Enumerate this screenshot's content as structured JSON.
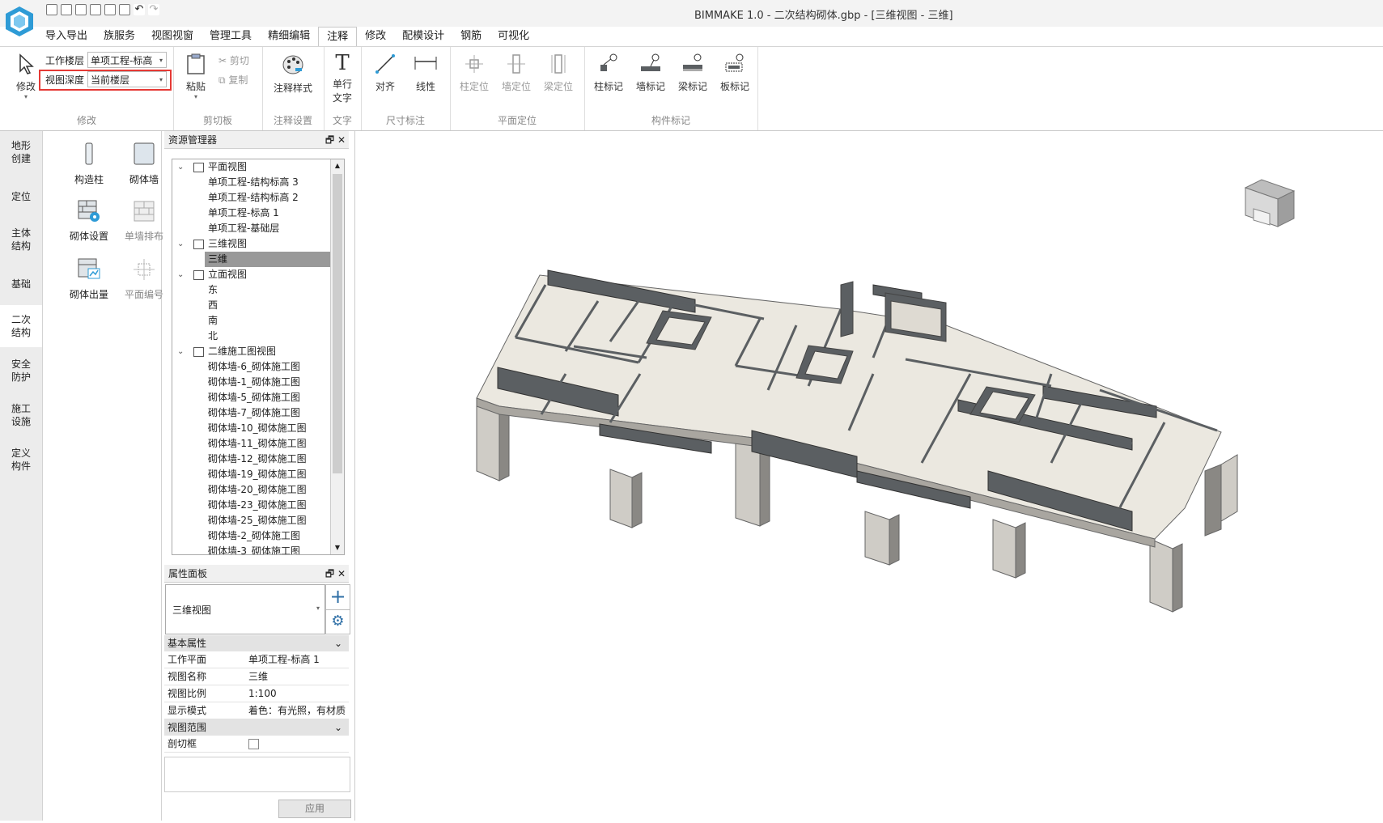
{
  "window": {
    "title": "BIMMAKE 1.0 - 二次结构砌体.gbp - [三维视图 - 三维]"
  },
  "menu_tabs": [
    "导入导出",
    "族服务",
    "视图视窗",
    "管理工具",
    "精细编辑",
    "注释",
    "修改",
    "配模设计",
    "钢筋",
    "可视化"
  ],
  "active_tab": "注释",
  "ribbon": {
    "modify": {
      "button": "修改",
      "work_floor_label": "工作楼层",
      "work_floor_value": "单项工程-标高",
      "view_depth_label": "视图深度",
      "view_depth_value": "当前楼层",
      "group": "修改"
    },
    "clipboard": {
      "paste": "粘贴",
      "cut": "剪切",
      "copy": "复制",
      "group": "剪切板"
    },
    "annotation_settings": {
      "style": "注释样式",
      "group": "注释设置"
    },
    "text": {
      "single_line": "单行\n文字",
      "single_line_a": "单行",
      "single_line_b": "文字",
      "group": "文字"
    },
    "dimension": {
      "align": "对齐",
      "linear": "线性",
      "group": "尺寸标注"
    },
    "plan_position": {
      "column": "柱定位",
      "wall": "墙定位",
      "beam": "梁定位",
      "group": "平面定位"
    },
    "component_mark": {
      "column": "柱标记",
      "wall": "墙标记",
      "beam": "梁标记",
      "slab": "板标记",
      "group": "构件标记"
    }
  },
  "left_nav": [
    {
      "a": "地形",
      "b": "创建"
    },
    {
      "a": "定位",
      "b": ""
    },
    {
      "a": "主体",
      "b": "结构"
    },
    {
      "a": "基础",
      "b": ""
    },
    {
      "a": "二次",
      "b": "结构"
    },
    {
      "a": "安全",
      "b": "防护"
    },
    {
      "a": "施工",
      "b": "设施"
    },
    {
      "a": "定义",
      "b": "构件"
    }
  ],
  "components": [
    {
      "label": "构造柱"
    },
    {
      "label": "砌体墙"
    },
    {
      "label": "砌体设置"
    },
    {
      "label": "单墙排布"
    },
    {
      "label": "砌体出量"
    },
    {
      "label": "平面编号"
    }
  ],
  "resource_manager": {
    "title": "资源管理器",
    "tree": [
      {
        "label": "平面视图",
        "level": 0
      },
      {
        "label": "单项工程-结构标高 3",
        "level": 1
      },
      {
        "label": "单项工程-结构标高 2",
        "level": 1
      },
      {
        "label": "单项工程-标高 1",
        "level": 1
      },
      {
        "label": "单项工程-基础层",
        "level": 1
      },
      {
        "label": "三维视图",
        "level": 0
      },
      {
        "label": "三维",
        "level": 1,
        "selected": true
      },
      {
        "label": "立面视图",
        "level": 0
      },
      {
        "label": "东",
        "level": 1
      },
      {
        "label": "西",
        "level": 1
      },
      {
        "label": "南",
        "level": 1
      },
      {
        "label": "北",
        "level": 1
      },
      {
        "label": "二维施工图视图",
        "level": 0
      },
      {
        "label": "砌体墙-6_砌体施工图",
        "level": 1
      },
      {
        "label": "砌体墙-1_砌体施工图",
        "level": 1
      },
      {
        "label": "砌体墙-5_砌体施工图",
        "level": 1
      },
      {
        "label": "砌体墙-7_砌体施工图",
        "level": 1
      },
      {
        "label": "砌体墙-10_砌体施工图",
        "level": 1
      },
      {
        "label": "砌体墙-11_砌体施工图",
        "level": 1
      },
      {
        "label": "砌体墙-12_砌体施工图",
        "level": 1
      },
      {
        "label": "砌体墙-19_砌体施工图",
        "level": 1
      },
      {
        "label": "砌体墙-20_砌体施工图",
        "level": 1
      },
      {
        "label": "砌体墙-23_砌体施工图",
        "level": 1
      },
      {
        "label": "砌体墙-25_砌体施工图",
        "level": 1
      },
      {
        "label": "砌体墙-2_砌体施工图",
        "level": 1
      },
      {
        "label": "砌体墙-3_砌体施工图",
        "level": 1
      }
    ]
  },
  "properties": {
    "title": "属性面板",
    "type_selector": "三维视图",
    "section_basic": "基本属性",
    "rows": [
      {
        "key": "工作平面",
        "value": "单项工程-标高 1"
      },
      {
        "key": "视图名称",
        "value": "三维"
      },
      {
        "key": "视图比例",
        "value": "1:100"
      },
      {
        "key": "显示模式",
        "value": "着色：有光照，有材质"
      }
    ],
    "section_range": "视图范围",
    "section_box_label": "剖切框",
    "apply_button": "应用"
  },
  "colors": {
    "accent": "#2e9bd6",
    "highlight_box": "#e53935",
    "slab": "#ebe8e0",
    "beam": "#5b5f62",
    "column": "#cfccc6"
  }
}
